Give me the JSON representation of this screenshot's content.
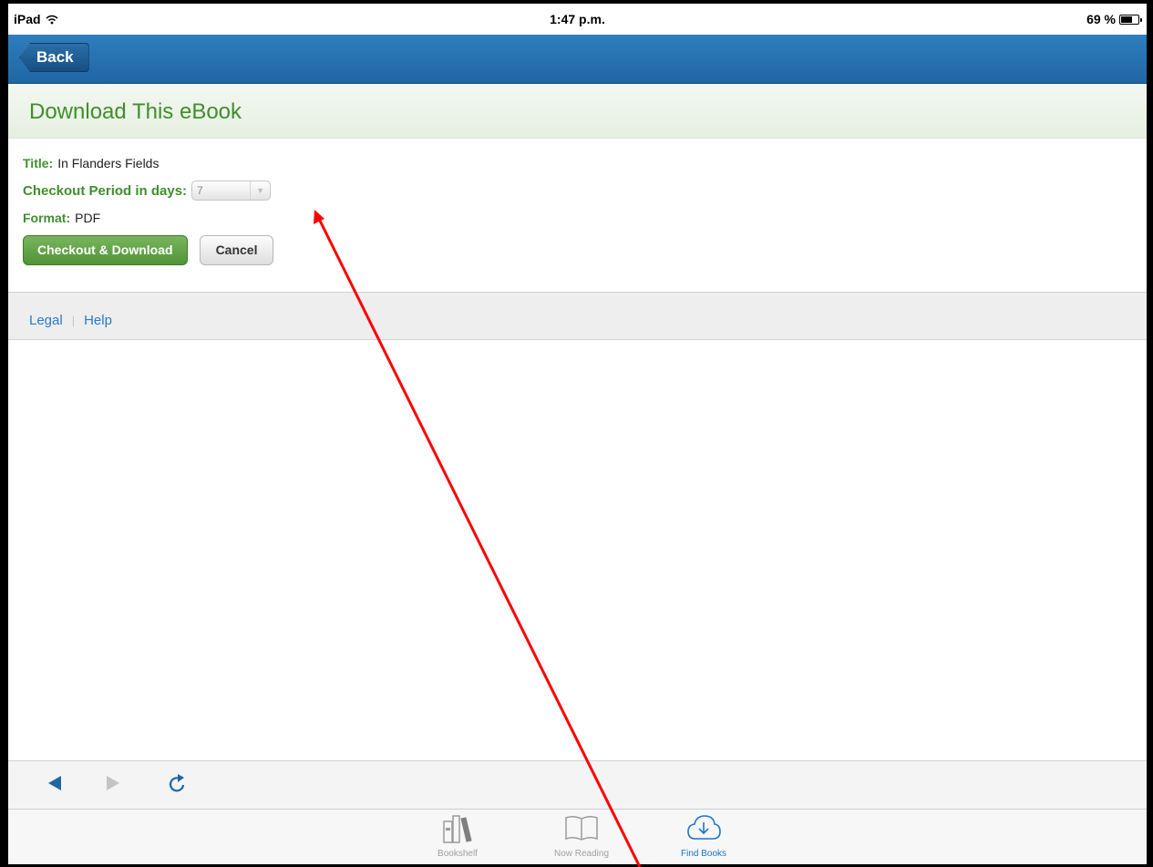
{
  "status_bar": {
    "device": "iPad",
    "time": "1:47 p.m.",
    "battery": "69 %",
    "battery_level": 0.69
  },
  "nav": {
    "back_label": "Back"
  },
  "page": {
    "title": "Download This eBook"
  },
  "form": {
    "title_label": "Title:",
    "title_value": "In Flanders Fields",
    "checkout_label": "Checkout Period in days:",
    "checkout_value": "7",
    "format_label": "Format:",
    "format_value": "PDF",
    "primary_button": "Checkout & Download",
    "cancel_button": "Cancel"
  },
  "footer": {
    "legal": "Legal",
    "help": "Help"
  },
  "browser_toolbar": {
    "icons": [
      "back-arrow-icon",
      "forward-arrow-icon",
      "reload-icon"
    ]
  },
  "tab_bar": {
    "tabs": [
      {
        "label": "Bookshelf",
        "icon": "bookshelf-icon",
        "active": false
      },
      {
        "label": "Now Reading",
        "icon": "open-book-icon",
        "active": false
      },
      {
        "label": "Find Books",
        "icon": "cloud-download-icon",
        "active": true
      }
    ]
  },
  "colors": {
    "nav_blue": "#1f66a4",
    "accent_green": "#3f8f2c",
    "link_blue": "#2a7ac8",
    "active_tab_blue": "#1d75c7",
    "annotation_red": "#ff0000"
  }
}
